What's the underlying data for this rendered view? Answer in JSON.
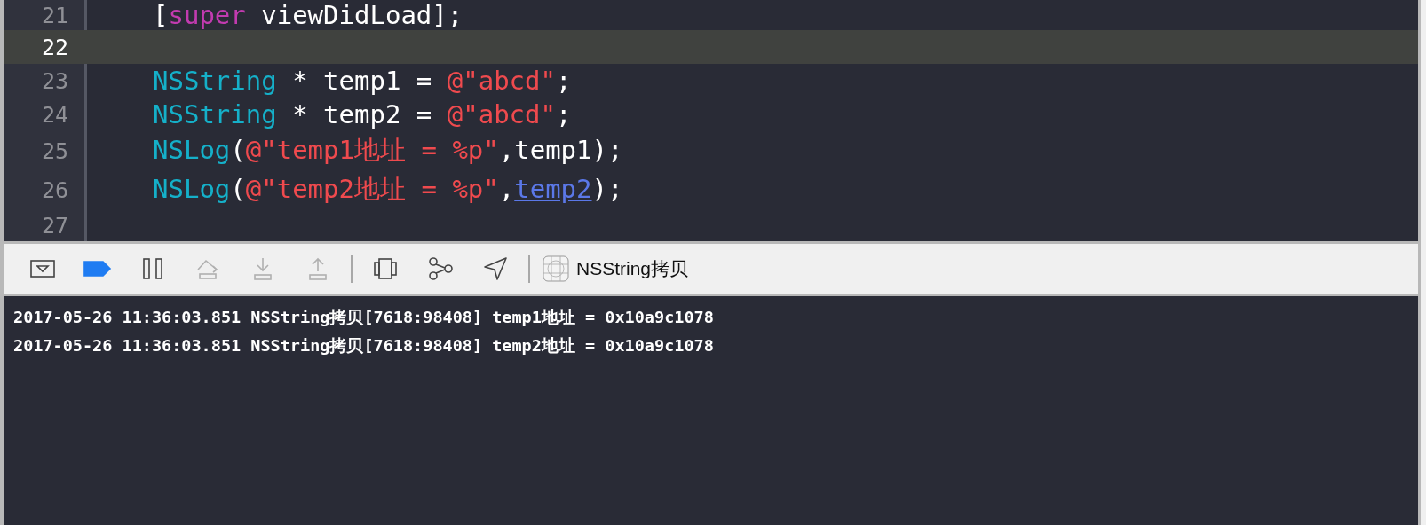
{
  "editor": {
    "lines": [
      {
        "number": "21",
        "current": false,
        "tokens": [
          {
            "kind": "plain",
            "text": "["
          },
          {
            "kind": "keyword",
            "text": "super"
          },
          {
            "kind": "plain",
            "text": " viewDidLoad];"
          }
        ]
      },
      {
        "number": "22",
        "current": true
      },
      {
        "number": "23",
        "current": false,
        "tokens": [
          {
            "kind": "type",
            "text": "NSString"
          },
          {
            "kind": "plain",
            "text": " * temp1 = "
          },
          {
            "kind": "string",
            "text": "@\"abcd\""
          },
          {
            "kind": "plain",
            "text": ";"
          }
        ]
      },
      {
        "number": "24",
        "current": false,
        "tokens": [
          {
            "kind": "type",
            "text": "NSString"
          },
          {
            "kind": "plain",
            "text": " * temp2 = "
          },
          {
            "kind": "string",
            "text": "@\"abcd\""
          },
          {
            "kind": "plain",
            "text": ";"
          }
        ]
      },
      {
        "number": "25",
        "current": false,
        "tokens": [
          {
            "kind": "type",
            "text": "NSLog"
          },
          {
            "kind": "plain",
            "text": "("
          },
          {
            "kind": "string",
            "text": "@\"temp1地址 = %p\""
          },
          {
            "kind": "plain",
            "text": ",temp1);"
          }
        ]
      },
      {
        "number": "26",
        "current": false,
        "tokens": [
          {
            "kind": "type",
            "text": "NSLog"
          },
          {
            "kind": "plain",
            "text": "("
          },
          {
            "kind": "string",
            "text": "@\"temp2地址 = %p\""
          },
          {
            "kind": "plain",
            "text": ","
          },
          {
            "kind": "link",
            "text": "temp2"
          },
          {
            "kind": "plain",
            "text": ");"
          }
        ]
      },
      {
        "number": "27",
        "current": false
      }
    ]
  },
  "debug_bar": {
    "buttons": [
      {
        "kind": "hide-console",
        "disabled": false
      },
      {
        "kind": "breakpoints",
        "disabled": false,
        "on": true
      },
      {
        "kind": "pause",
        "disabled": false
      },
      {
        "kind": "step-over",
        "disabled": true
      },
      {
        "kind": "step-into",
        "disabled": true
      },
      {
        "kind": "step-out",
        "disabled": true
      },
      {
        "kind": "view-hierarchy",
        "disabled": false
      },
      {
        "kind": "memory-graph",
        "disabled": false
      },
      {
        "kind": "location",
        "disabled": false
      }
    ],
    "target": "NSString拷贝"
  },
  "console": {
    "lines": [
      "2017-05-26 11:36:03.851 NSString拷贝[7618:98408] temp1地址 = 0x10a9c1078",
      "2017-05-26 11:36:03.851 NSString拷贝[7618:98408] temp2地址 = 0x10a9c1078"
    ]
  }
}
